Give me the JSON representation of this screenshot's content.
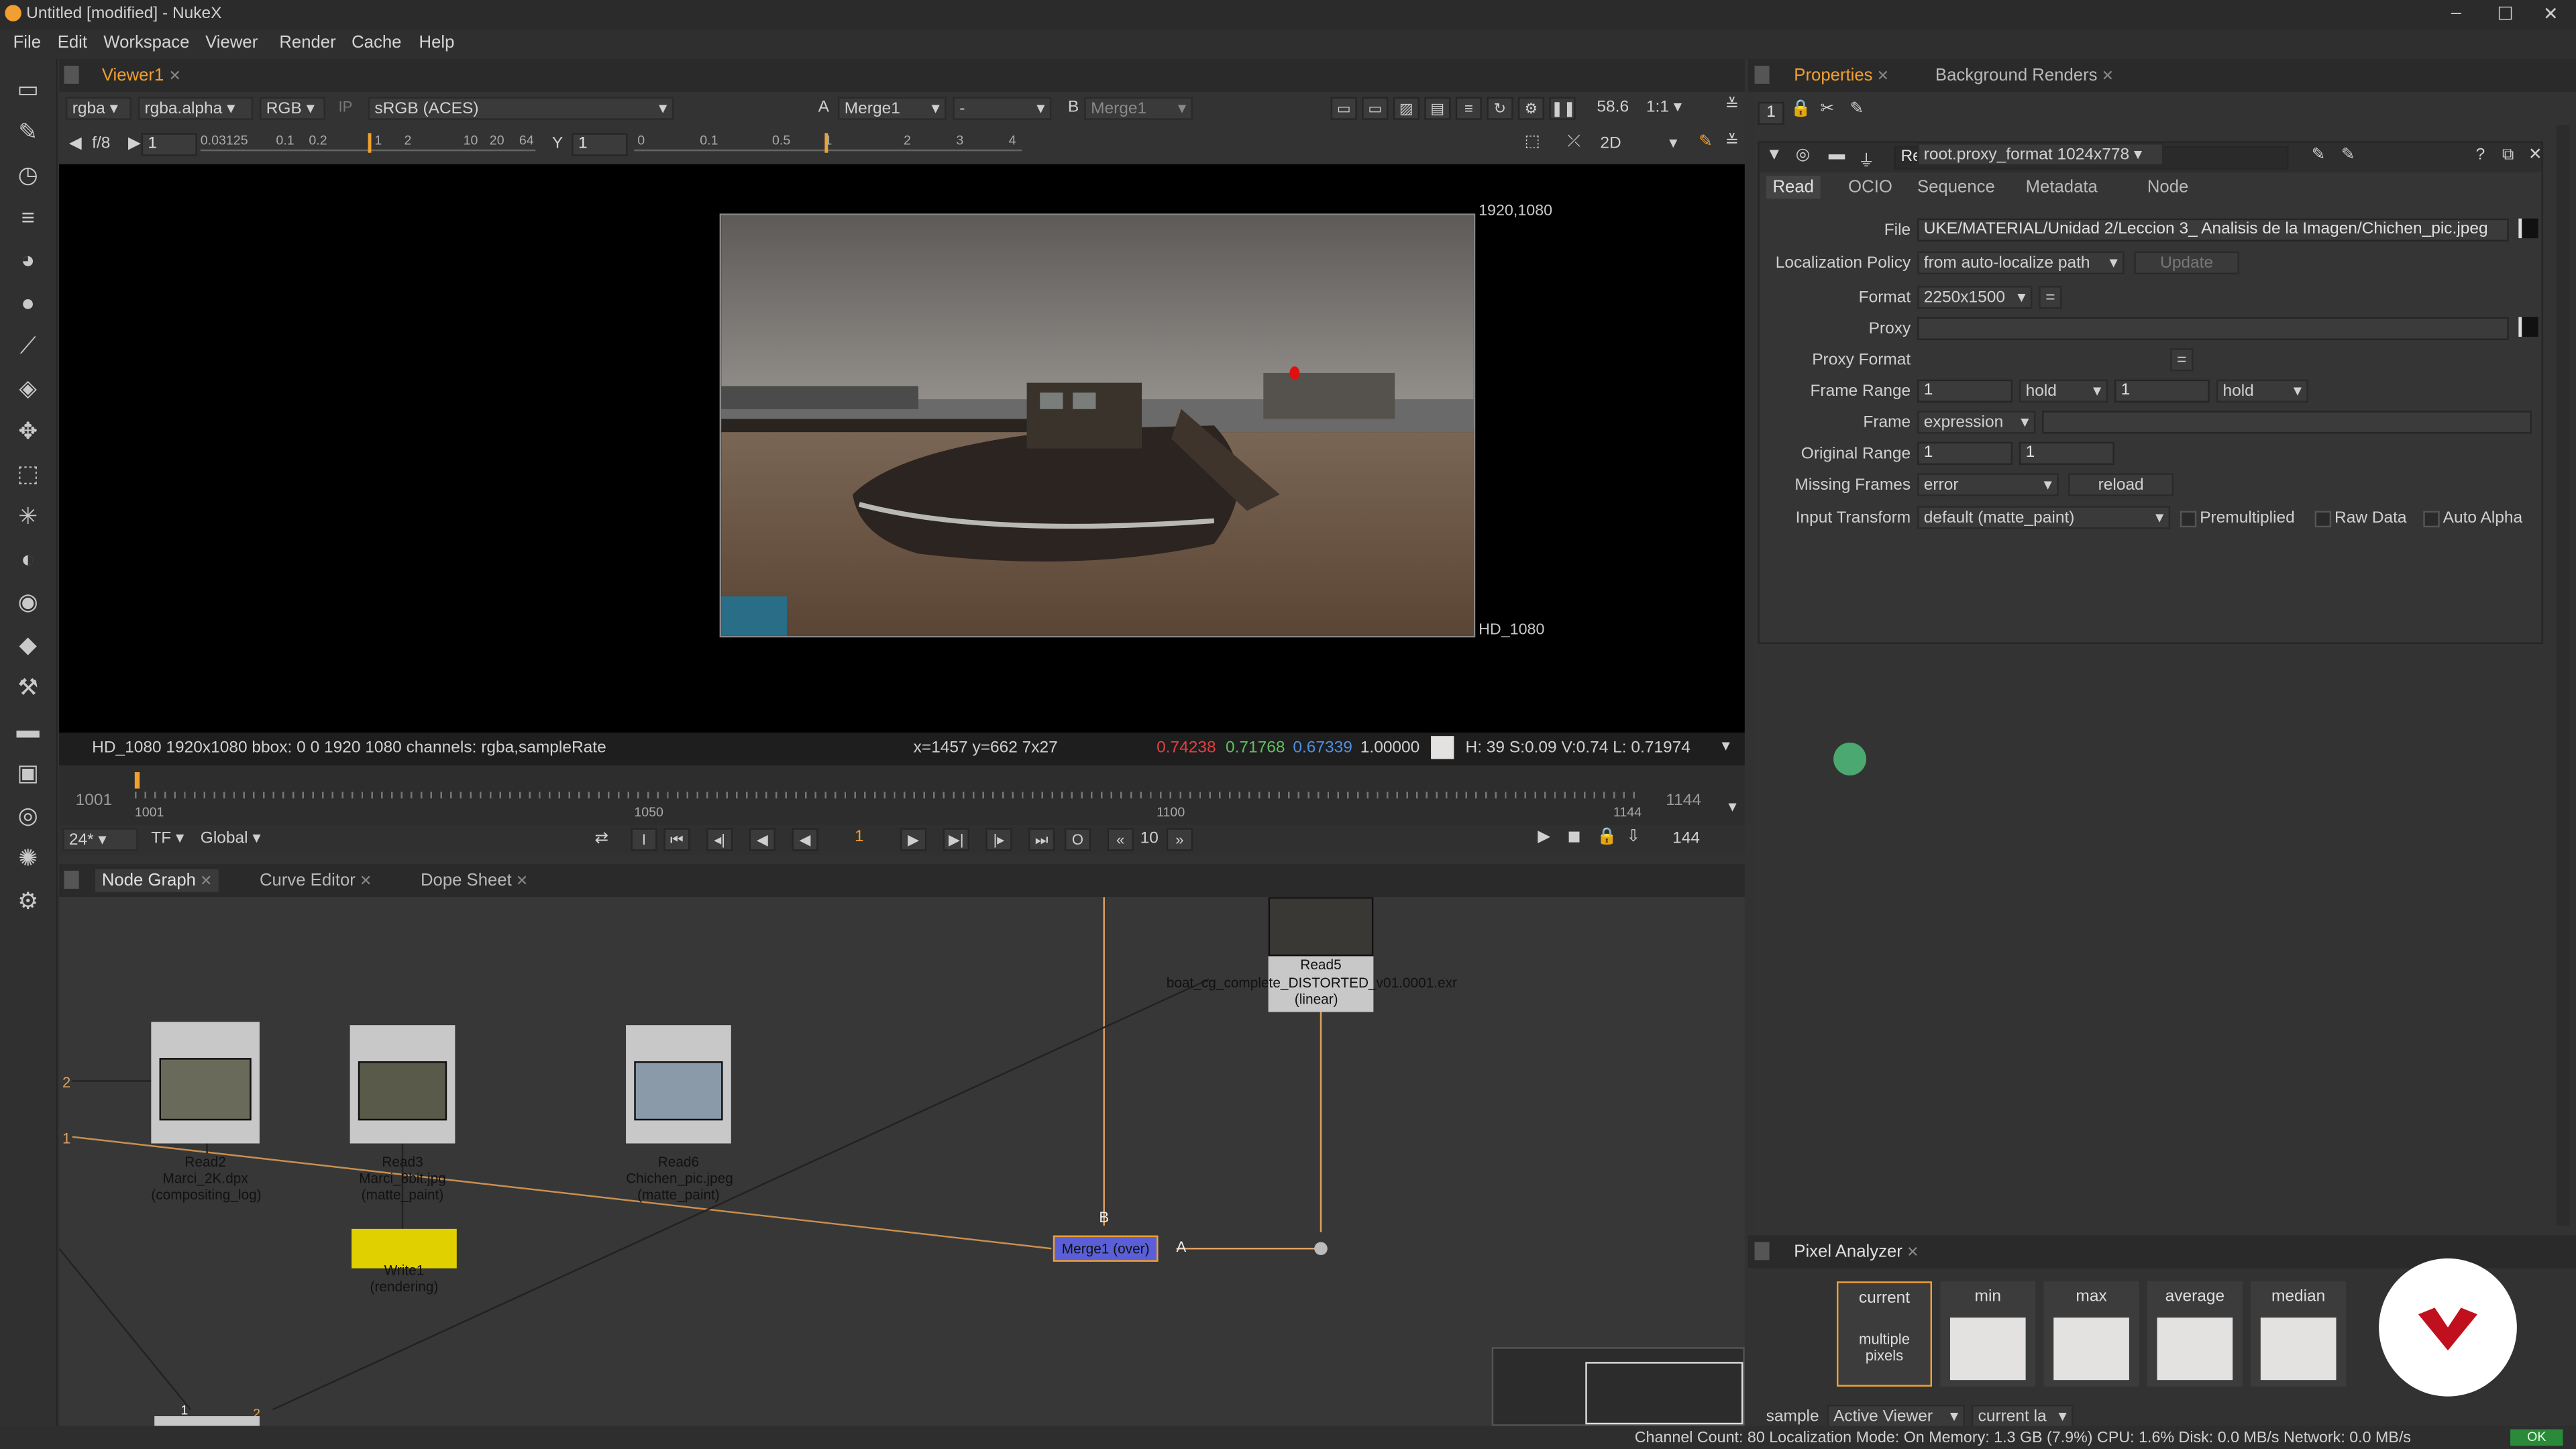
{
  "window": {
    "title": "Untitled [modified] - NukeX"
  },
  "menu": [
    "File",
    "Edit",
    "Workspace",
    "Viewer",
    "Render",
    "Cache",
    "Help"
  ],
  "viewer": {
    "tab_label": "Viewer1",
    "channels": "rgba",
    "alpha": "rgba.alpha",
    "display_channels": "RGB",
    "ip": "IP",
    "colorspace": "sRGB (ACES)",
    "input_a_letter": "A",
    "input_a": "Merge1",
    "op": "-",
    "input_b_letter": "B",
    "input_b": "Merge1",
    "zoom": "58.6",
    "ratio": "1:1",
    "fstop": "f/8",
    "frame_field": "1",
    "y_label": "Y",
    "y_field": "1",
    "gain_ticks": [
      "0.03125",
      "0.1",
      "0.2",
      "1",
      "2",
      "10",
      "20",
      "64"
    ],
    "gamma_ticks": [
      "0",
      "0.1",
      "0.5",
      "1",
      "2",
      "3",
      "4"
    ],
    "view_mode": "2D",
    "format_tr": "1920,1080",
    "format_br": "HD_1080",
    "info_left": "HD_1080 1920x1080  bbox: 0 0 1920 1080 channels: rgba,sampleRate",
    "info_xy": "x=1457 y=662 7x27",
    "px_r": "0.74238",
    "px_g": "0.71768",
    "px_b": "0.67339",
    "px_a": "1.00000",
    "px_hsvl": "H: 39 S:0.09 V:0.74  L: 0.71974"
  },
  "timeline": {
    "start_field": "1001",
    "end_field": "1144",
    "labels": [
      "1001",
      "1050",
      "1100",
      "1144"
    ],
    "fps": "24*",
    "tf": "TF",
    "global": "Global",
    "current_frame": "1",
    "step": "10",
    "end_frame": "144"
  },
  "bottom_tabs": [
    "Node Graph",
    "Curve Editor",
    "Dope Sheet"
  ],
  "nodes": {
    "read2": "Read2\nMarci_2K.dpx\n(compositing_log)",
    "read3": "Read3\nMarci_8bit.jpg\n(matte_paint)",
    "read6": "Read6\nChichen_pic.jpeg\n(matte_paint)",
    "read5_title": "Read5",
    "read5_file": "boat_cg_complete_DISTORTED_v01.0001.exr",
    "read5_cs": "(linear)",
    "write1": "Write1\n(rendering)",
    "merge1": "Merge1 (over)",
    "input_a": "A",
    "input_b": "B",
    "marker2": "2",
    "marker1": "1",
    "bottom_1": "1",
    "bottom_2": "2"
  },
  "properties": {
    "tabs": [
      "Properties",
      "Background Renders"
    ],
    "panel_count": "1",
    "node_name": "Read6",
    "node_tabs": [
      "Read",
      "OCIO",
      "Sequence",
      "Metadata",
      "Node"
    ],
    "file_label": "File",
    "file_value": "UKE/MATERIAL/Unidad 2/Leccion 3_ Analisis de la Imagen/Chichen_pic.jpeg",
    "localization_label": "Localization Policy",
    "localization_value": "from auto-localize path",
    "update_btn": "Update",
    "format_label": "Format",
    "format_value": "2250x1500",
    "proxy_label": "Proxy",
    "proxy_format_label": "Proxy Format",
    "proxy_format_value": "root.proxy_format 1024x778",
    "frame_range_label": "Frame Range",
    "frame_range_start": "1",
    "frame_range_before": "hold",
    "frame_range_end": "1",
    "frame_range_after": "hold",
    "frame_label": "Frame",
    "frame_value": "expression",
    "original_range_label": "Original Range",
    "original_range_start": "1",
    "original_range_end": "1",
    "missing_frames_label": "Missing Frames",
    "missing_frames_value": "error",
    "reload_btn": "reload",
    "input_transform_label": "Input Transform",
    "input_transform_value": "default (matte_paint)",
    "premultiplied": "Premultiplied",
    "raw_data": "Raw Data",
    "auto_alpha": "Auto Alpha",
    "equals_btn": "="
  },
  "pixel_analyzer": {
    "tab": "Pixel Analyzer",
    "boxes": [
      "current",
      "min",
      "max",
      "average",
      "median"
    ],
    "current_sub": "multiple\npixels",
    "sample_label": "sample",
    "sample_value": "Active Viewer",
    "current_layer": "current la"
  },
  "status": {
    "text": "Channel Count: 80  Localization Mode: On  Memory: 1.3 GB (7.9%)  CPU: 1.6%  Disk: 0.0 MB/s  Network: 0.0 MB/s",
    "ok": "OK"
  },
  "colors": {
    "accent": "#f0a030",
    "merge_node": "#5a5fd8",
    "write_node": "#e0d000",
    "read_node": "#c0c0c0",
    "brand_red": "#c0101e"
  }
}
